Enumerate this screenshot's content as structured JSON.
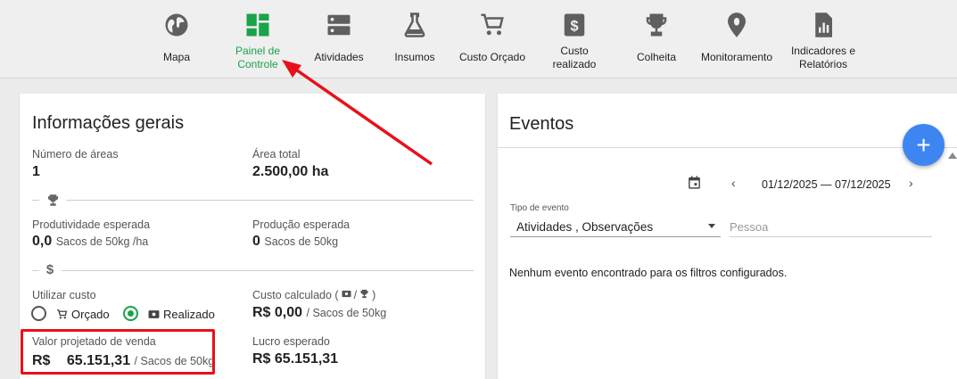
{
  "nav": {
    "items": [
      {
        "label": "Mapa",
        "icon": "globe-icon"
      },
      {
        "label": "Painel de Controle",
        "icon": "dashboard-icon",
        "active": true
      },
      {
        "label": "Atividades",
        "icon": "storage-icon"
      },
      {
        "label": "Insumos",
        "icon": "flask-icon"
      },
      {
        "label": "Custo Orçado",
        "icon": "cart-icon"
      },
      {
        "label": "Custo realizado",
        "icon": "money-icon"
      },
      {
        "label": "Colheita",
        "icon": "trophy-icon"
      },
      {
        "label": "Monitoramento",
        "icon": "bug-location-icon"
      },
      {
        "label": "Indicadores e Relatórios",
        "icon": "report-icon"
      }
    ]
  },
  "info": {
    "title": "Informações gerais",
    "num_areas_label": "Número de áreas",
    "num_areas_value": "1",
    "area_total_label": "Área total",
    "area_total_value": "2.500,00 ha",
    "prod_esperada_label": "Produtividade esperada",
    "prod_esperada_value": "0,0",
    "prod_esperada_unit": "Sacos de 50kg /ha",
    "producao_label": "Produção esperada",
    "producao_value": "0",
    "producao_unit": "Sacos de 50kg",
    "utilizar_custo_label": "Utilizar custo",
    "opt_orcado": "Orçado",
    "opt_realizado": "Realizado",
    "selected_option": "Realizado",
    "custo_calc_label_pre": "Custo calculado (",
    "custo_calc_label_mid": "/",
    "custo_calc_label_post": ")",
    "custo_calc_value": "R$ 0,00",
    "custo_calc_unit": "/ Sacos de 50kg",
    "valor_proj_label": "Valor projetado de venda",
    "valor_proj_currency": "R$",
    "valor_proj_value": "65.151,31",
    "valor_proj_unit": "/ Sacos de 50kg",
    "lucro_label": "Lucro esperado",
    "lucro_value": "R$ 65.151,31"
  },
  "eventos": {
    "title": "Eventos",
    "date_range": "01/12/2025 — 07/12/2025",
    "tipo_label": "Tipo de evento",
    "tipo_value": "Atividades , Observações",
    "pessoa_placeholder": "Pessoa",
    "empty_message": "Nenhum evento encontrado para os filtros configurados.",
    "add_label": "+"
  },
  "colors": {
    "active_green": "#1aa34a",
    "fab_blue": "#3d86f2",
    "annotation_red": "#e8101a"
  }
}
